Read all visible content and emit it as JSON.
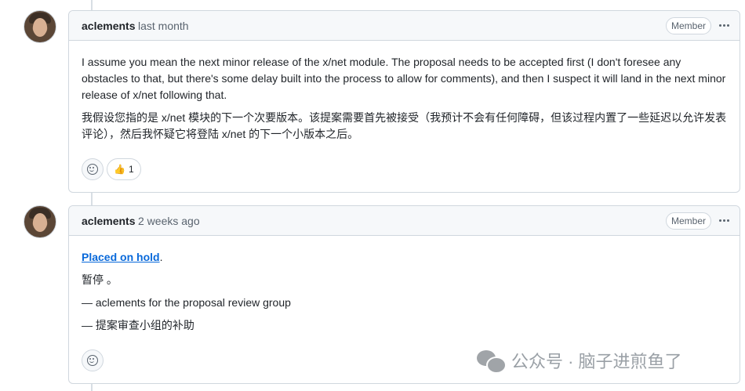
{
  "comments": [
    {
      "author": "aclements",
      "time": "last month",
      "badge": "Member",
      "paragraphs": [
        "I assume you mean the next minor release of the x/net module. The proposal needs to be accepted first (I don't foresee any obstacles to that, but there's some delay built into the process to allow for comments), and then I suspect it will land in the next minor release of x/net following that.",
        "我假设您指的是 x/net 模块的下一个次要版本。该提案需要首先被接受（我预计不会有任何障碍，但该过程内置了一些延迟以允许发表评论），然后我怀疑它将登陆 x/net 的下一个小版本之后。"
      ],
      "reactions": [
        {
          "icon": "thumbs-up-icon",
          "emoji": "👍",
          "count": "1"
        }
      ]
    },
    {
      "author": "aclements",
      "time": "2 weeks ago",
      "badge": "Member",
      "link_text": "Placed on hold",
      "link_suffix": ".",
      "lines": [
        "暂停 。",
        "— aclements for the proposal review group",
        "— 提案审查小组的补助"
      ]
    }
  ],
  "watermark": {
    "text": "公众号 · 脑子进煎鱼了",
    "icon": "wechat-icon"
  },
  "colors": {
    "link": "#0969da",
    "border": "#d0d7de",
    "header_bg": "#f6f8fa",
    "muted_text": "#59636e"
  }
}
